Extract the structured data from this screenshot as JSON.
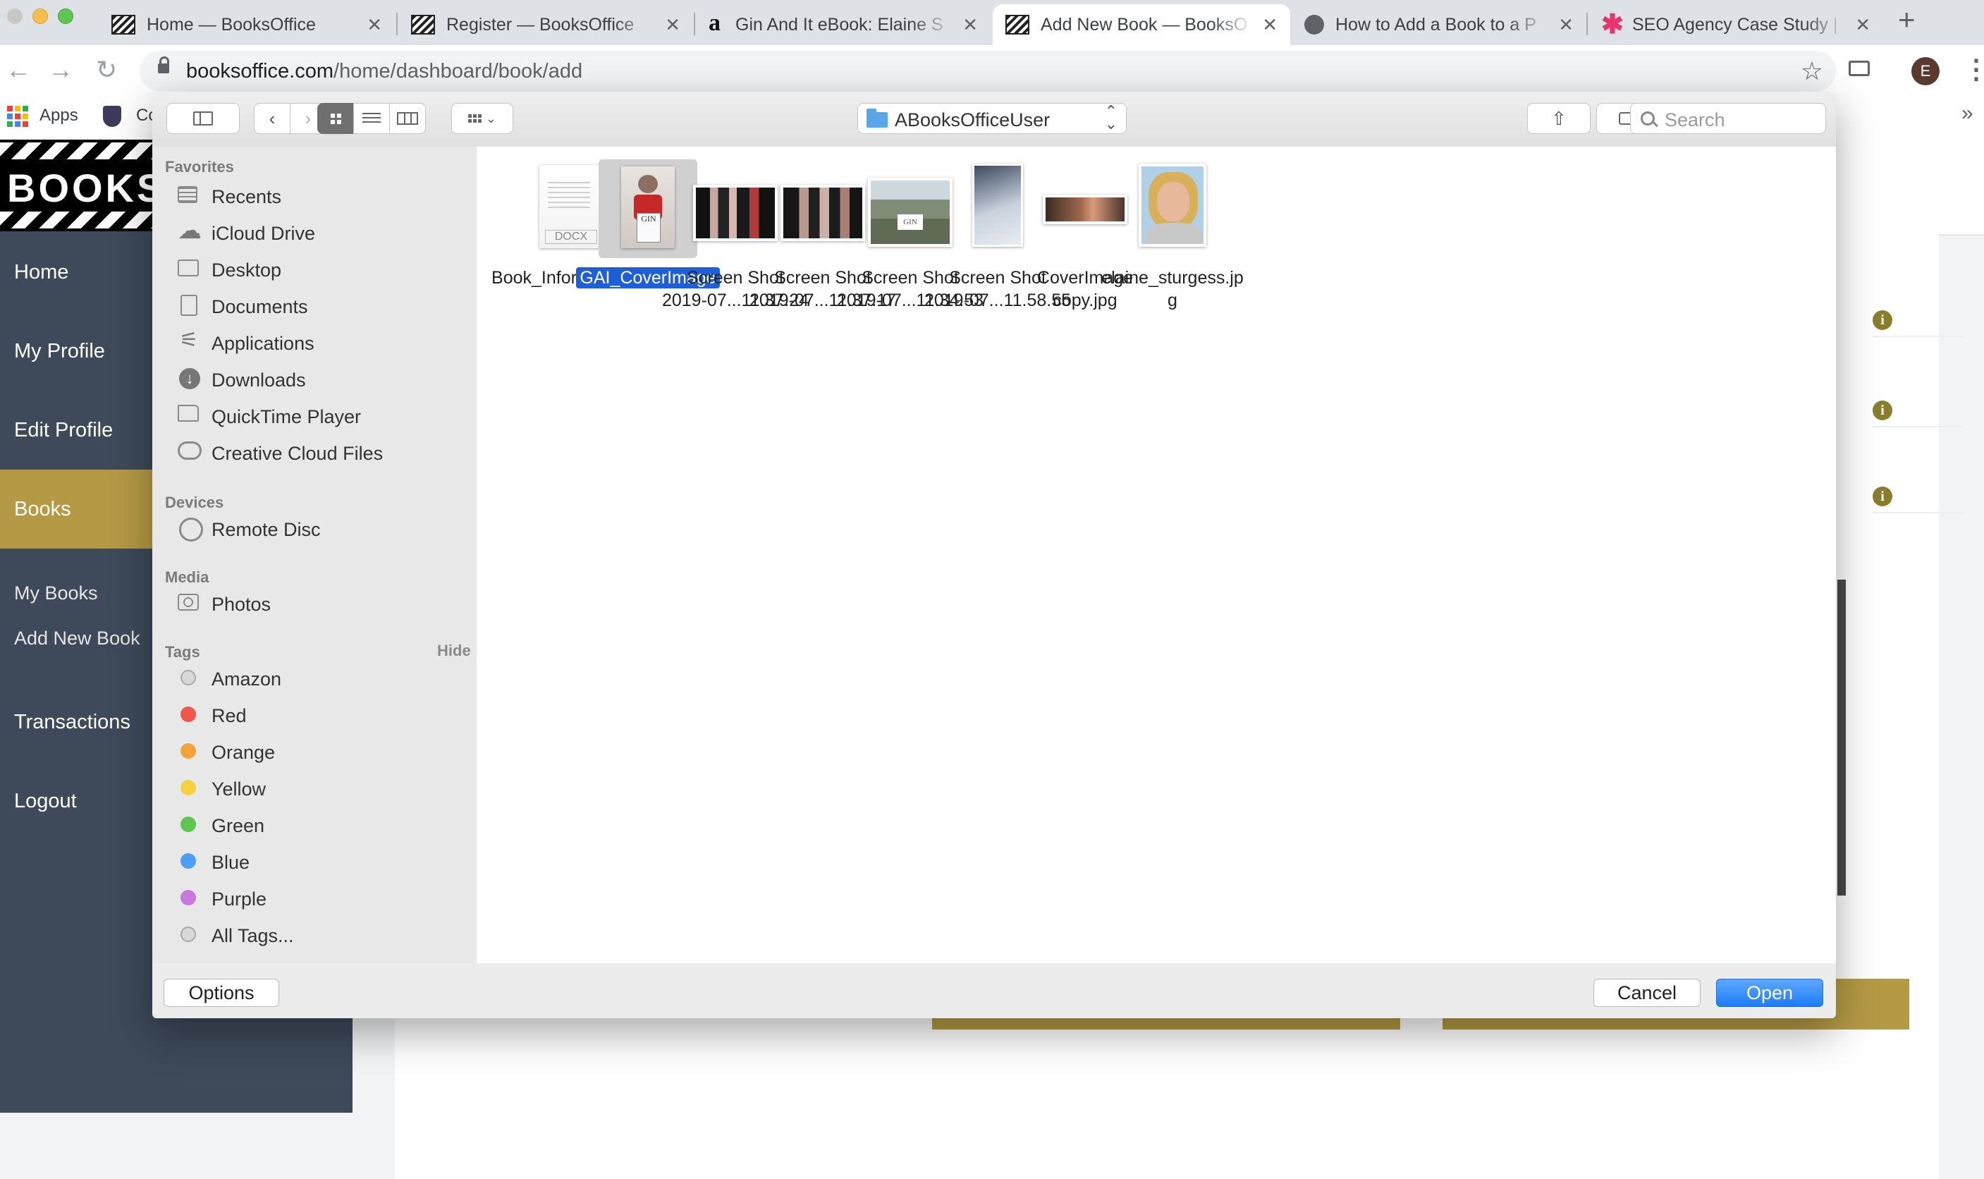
{
  "browser": {
    "tabs": [
      {
        "title": "Home — BooksOffice",
        "icon": "booksoffice-favicon"
      },
      {
        "title": "Register — BooksOffice",
        "icon": "booksoffice-favicon"
      },
      {
        "title": "Gin And It eBook: Elaine S",
        "icon": "amazon-favicon"
      },
      {
        "title": "Add New Book — BooksO",
        "icon": "booksoffice-favicon",
        "active": true
      },
      {
        "title": "How to Add a Book to a P",
        "icon": "globe-favicon"
      },
      {
        "title": "SEO Agency Case Study |",
        "icon": "asterisk-favicon"
      }
    ],
    "url_domain": "booksoffice.com",
    "url_path": "/home/dashboard/book/add",
    "avatar_letter": "E",
    "bookmarks": {
      "apps": "Apps",
      "co": "Co"
    }
  },
  "site": {
    "logo": "BOOKS",
    "nav": [
      "Home",
      "My Profile",
      "Edit Profile",
      "Books"
    ],
    "sub_nav": [
      "My Books",
      "Add New Book"
    ],
    "nav_bottom": [
      "Transactions",
      "Logout"
    ],
    "accent": "#b59a45"
  },
  "dialog": {
    "folder": "ABooksOfficeUser",
    "search_placeholder": "Search",
    "sidebar": {
      "favorites_heading": "Favorites",
      "favorites": [
        {
          "label": "Recents",
          "icon": "clock-icon"
        },
        {
          "label": "iCloud Drive",
          "icon": "cloud-icon"
        },
        {
          "label": "Desktop",
          "icon": "desktop-icon"
        },
        {
          "label": "Documents",
          "icon": "documents-icon"
        },
        {
          "label": "Applications",
          "icon": "applications-icon"
        },
        {
          "label": "Downloads",
          "icon": "download-icon"
        },
        {
          "label": "QuickTime Player",
          "icon": "folder-icon"
        },
        {
          "label": "Creative Cloud Files",
          "icon": "creative-cloud-icon"
        }
      ],
      "devices_heading": "Devices",
      "devices": [
        {
          "label": "Remote Disc",
          "icon": "disc-icon"
        }
      ],
      "media_heading": "Media",
      "media": [
        {
          "label": "Photos",
          "icon": "camera-icon"
        }
      ],
      "tags_heading": "Tags",
      "hide_label": "Hide",
      "tags": [
        {
          "label": "Amazon",
          "color": "#d8d8d8"
        },
        {
          "label": "Red",
          "color": "#f0574a"
        },
        {
          "label": "Orange",
          "color": "#f5a23b"
        },
        {
          "label": "Yellow",
          "color": "#f7d042"
        },
        {
          "label": "Green",
          "color": "#5dc650"
        },
        {
          "label": "Blue",
          "color": "#4d9ef5"
        },
        {
          "label": "Purple",
          "color": "#c779dd"
        },
        {
          "label": "All Tags...",
          "color": "#d8d8d8"
        }
      ]
    },
    "files": [
      {
        "name1": "Book_Information",
        "name2": "",
        "kind": "docx",
        "badge": "DOCX"
      },
      {
        "name1": "GAI_CoverImage",
        "name2": "",
        "kind": "cover",
        "badge": "GIN",
        "selected": true
      },
      {
        "name1": "Screen Shot",
        "name2": "2019-07...11.37.24",
        "kind": "photo-dark"
      },
      {
        "name1": "Screen Shot",
        "name2": "2019-07...11.37.17",
        "kind": "photo-dark"
      },
      {
        "name1": "Screen Shot",
        "name2": "2019-07...11.34.53",
        "kind": "landscape",
        "badge": "GIN"
      },
      {
        "name1": "Screen Shot",
        "name2": "2019-07...11.58.55",
        "kind": "portrait-cover"
      },
      {
        "name1": "CoverImage",
        "name2": "copy.jpg",
        "kind": "banner"
      },
      {
        "name1": "elaine_sturgess.jp",
        "name2": "g",
        "kind": "headshot"
      }
    ],
    "options_label": "Options",
    "cancel_label": "Cancel",
    "open_label": "Open"
  }
}
